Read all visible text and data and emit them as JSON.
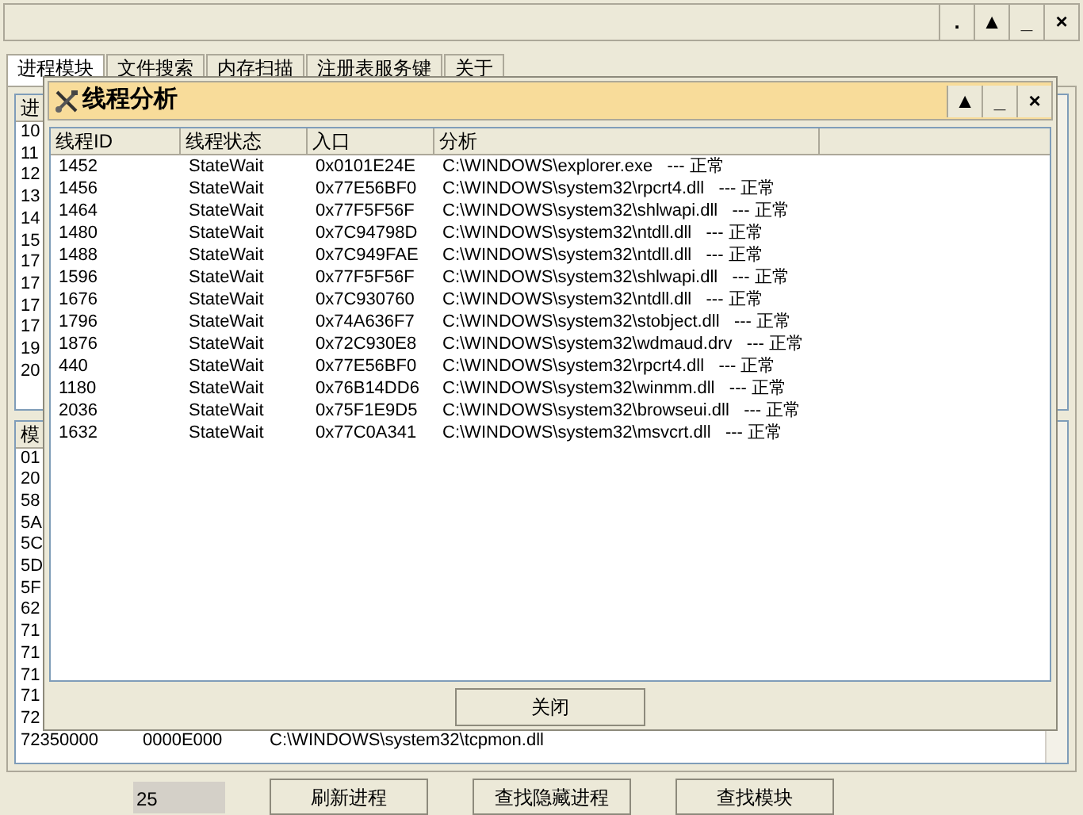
{
  "main_window": {
    "title_buttons": [
      ".",
      "▲",
      "_",
      "×"
    ],
    "tabs": [
      {
        "label": "进程模块",
        "selected": true
      },
      {
        "label": "文件搜索",
        "selected": false
      },
      {
        "label": "内存扫描",
        "selected": false
      },
      {
        "label": "注册表服务键",
        "selected": false
      },
      {
        "label": "关于",
        "selected": false
      }
    ],
    "process_list": {
      "column_1": "进",
      "rows": [
        "10",
        "11",
        "12",
        "13",
        "14",
        "15",
        "17",
        "17",
        "17",
        "17",
        "19",
        "20"
      ]
    },
    "module_list": {
      "column_1": "模",
      "rows": [
        "01",
        "20",
        "58",
        "5A",
        "5C",
        "5D",
        "5F",
        "62",
        "71",
        "71",
        "71",
        "71",
        "72"
      ],
      "last_row": [
        "72350000",
        "0000E000",
        "C:\\WINDOWS\\system32\\tcpmon.dll"
      ]
    },
    "count": "25",
    "buttons": [
      "刷新进程",
      "查找隐藏进程",
      "查找模块"
    ]
  },
  "dialog": {
    "title": "线程分析",
    "title_buttons": [
      "▲",
      "_",
      "×"
    ],
    "columns": [
      "线程ID",
      "线程状态",
      "入口",
      "分析"
    ],
    "rows": [
      {
        "id": "1452",
        "state": "StateWait",
        "entry": "0x0101E24E",
        "analysis": "C:\\WINDOWS\\explorer.exe   --- 正常"
      },
      {
        "id": "1456",
        "state": "StateWait",
        "entry": "0x77E56BF0",
        "analysis": "C:\\WINDOWS\\system32\\rpcrt4.dll   --- 正常"
      },
      {
        "id": "1464",
        "state": "StateWait",
        "entry": "0x77F5F56F",
        "analysis": "C:\\WINDOWS\\system32\\shlwapi.dll   --- 正常"
      },
      {
        "id": "1480",
        "state": "StateWait",
        "entry": "0x7C94798D",
        "analysis": "C:\\WINDOWS\\system32\\ntdll.dll   --- 正常"
      },
      {
        "id": "1488",
        "state": "StateWait",
        "entry": "0x7C949FAE",
        "analysis": "C:\\WINDOWS\\system32\\ntdll.dll   --- 正常"
      },
      {
        "id": "1596",
        "state": "StateWait",
        "entry": "0x77F5F56F",
        "analysis": "C:\\WINDOWS\\system32\\shlwapi.dll   --- 正常"
      },
      {
        "id": "1676",
        "state": "StateWait",
        "entry": "0x7C930760",
        "analysis": "C:\\WINDOWS\\system32\\ntdll.dll   --- 正常"
      },
      {
        "id": "1796",
        "state": "StateWait",
        "entry": "0x74A636F7",
        "analysis": "C:\\WINDOWS\\system32\\stobject.dll   --- 正常"
      },
      {
        "id": "1876",
        "state": "StateWait",
        "entry": "0x72C930E8",
        "analysis": "C:\\WINDOWS\\system32\\wdmaud.drv   --- 正常"
      },
      {
        "id": "440",
        "state": "StateWait",
        "entry": "0x77E56BF0",
        "analysis": "C:\\WINDOWS\\system32\\rpcrt4.dll   --- 正常"
      },
      {
        "id": "1180",
        "state": "StateWait",
        "entry": "0x76B14DD6",
        "analysis": "C:\\WINDOWS\\system32\\winmm.dll   --- 正常"
      },
      {
        "id": "2036",
        "state": "StateWait",
        "entry": "0x75F1E9D5",
        "analysis": "C:\\WINDOWS\\system32\\browseui.dll   --- 正常"
      },
      {
        "id": "1632",
        "state": "StateWait",
        "entry": "0x77C0A341",
        "analysis": "C:\\WINDOWS\\system32\\msvcrt.dll   --- 正常"
      }
    ],
    "close_button": "关闭"
  }
}
